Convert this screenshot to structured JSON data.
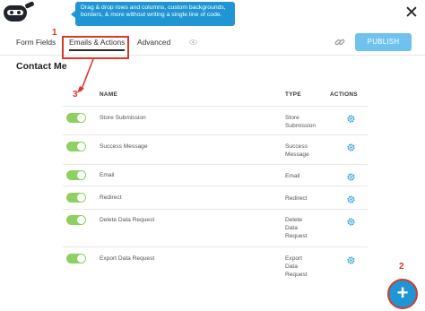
{
  "tooltip": {
    "text": "Drag & drop rows and columns, custom backgrounds, borders, & more without writing a single line of code."
  },
  "close": {
    "glyph": "✕"
  },
  "tabs": [
    {
      "label": "Form Fields"
    },
    {
      "label": "Emails & Actions"
    },
    {
      "label": "Advanced"
    }
  ],
  "toolbar": {
    "publish_label": "PUBLISH"
  },
  "form": {
    "title": "Contact Me"
  },
  "table": {
    "headers": {
      "name": "NAME",
      "type": "TYPE",
      "actions": "ACTIONS"
    },
    "rows": [
      {
        "name": "Store Submission",
        "type": "Store Submission",
        "enabled": true
      },
      {
        "name": "Success Message",
        "type": "Success Message",
        "enabled": true
      },
      {
        "name": "Email",
        "type": "Email",
        "enabled": true
      },
      {
        "name": "Redirect",
        "type": "Redirect",
        "enabled": true
      },
      {
        "name": "Delete Data Request",
        "type": "Delete Data Request",
        "enabled": true
      },
      {
        "name": "Export Data Request",
        "type": "Export Data Request",
        "enabled": true
      }
    ]
  },
  "annotations": {
    "one": "1",
    "two": "2",
    "three": "3"
  },
  "fab": {
    "glyph": "+"
  },
  "colors": {
    "accent": "#1f96d3",
    "toggle_on": "#8ed061",
    "annotation": "#d53a2a",
    "publish": "#6ec2ed"
  },
  "icons": [
    "ninja-logo-icon",
    "close-icon",
    "eye-icon",
    "link-icon",
    "gear-icon",
    "plus-icon"
  ]
}
